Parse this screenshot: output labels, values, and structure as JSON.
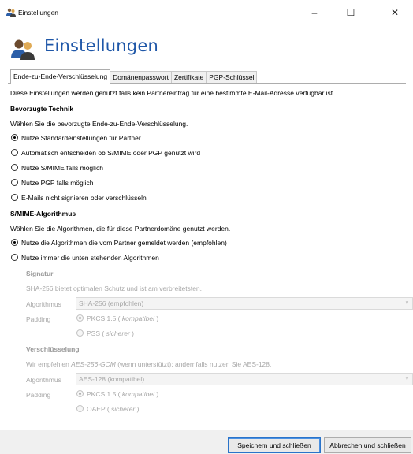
{
  "window": {
    "title": "Einstellungen",
    "minimize_glyph": "–",
    "maximize_glyph": "☐",
    "close_glyph": "✕"
  },
  "header": {
    "title": "Einstellungen"
  },
  "tabs": [
    {
      "label": "Ende-zu-Ende-Verschlüsselung",
      "active": true
    },
    {
      "label": "Domänenpasswort",
      "active": false
    },
    {
      "label": "Zertifikate",
      "active": false
    },
    {
      "label": "PGP-Schlüssel",
      "active": false
    }
  ],
  "intro": "Diese Einstellungen werden genutzt falls kein Partnereintrag für eine bestimmte E-Mail-Adresse verfügbar ist.",
  "technique": {
    "heading": "Bevorzugte Technik",
    "description": "Wählen Sie die bevorzugte Ende-zu-Ende-Verschlüsselung.",
    "options": [
      {
        "label": "Nutze Standardeinstellungen für Partner",
        "checked": true
      },
      {
        "label": "Automatisch entscheiden ob S/MIME oder PGP genutzt wird",
        "checked": false
      },
      {
        "label": "Nutze S/MIME falls möglich",
        "checked": false
      },
      {
        "label": "Nutze PGP falls möglich",
        "checked": false
      },
      {
        "label": "E-Mails nicht signieren oder verschlüsseln",
        "checked": false
      }
    ]
  },
  "smime": {
    "heading": "S/MIME-Algorithmus",
    "description": "Wählen Sie die Algorithmen, die für diese Partnerdomäne genutzt werden.",
    "options": [
      {
        "label": "Nutze die Algorithmen die vom Partner gemeldet werden (empfohlen)",
        "checked": true
      },
      {
        "label": "Nutze immer die unten stehenden Algorithmen",
        "checked": false
      }
    ]
  },
  "signature": {
    "heading": "Signatur",
    "description": "SHA-256 bietet optimalen Schutz und ist am verbreitetsten.",
    "algorithm_label": "Algorithmus",
    "algorithm_value": "SHA-256 (empfohlen)",
    "padding_label": "Padding",
    "padding_options": [
      {
        "prefix": "PKCS 1.5 ( ",
        "emphasis": "kompatibel",
        "suffix": " )",
        "checked": true
      },
      {
        "prefix": "PSS ( ",
        "emphasis": "sicherer",
        "suffix": " )",
        "checked": false
      }
    ]
  },
  "encryption": {
    "heading": "Verschlüsselung",
    "description_prefix": "Wir empfehlen ",
    "description_emphasis": "AES-256-GCM",
    "description_suffix": " (wenn unterstützt); andernfalls nutzen Sie AES-128.",
    "algorithm_label": "Algorithmus",
    "algorithm_value": "AES-128 (kompatibel)",
    "padding_label": "Padding",
    "padding_options": [
      {
        "prefix": "PKCS 1.5 ( ",
        "emphasis": "kompatibel",
        "suffix": " )",
        "checked": true
      },
      {
        "prefix": "OAEP ( ",
        "emphasis": "sicherer",
        "suffix": " )",
        "checked": false
      }
    ]
  },
  "footer": {
    "save_label": "Speichern und schließen",
    "cancel_label": "Abbrechen und schließen"
  },
  "colors": {
    "accent": "#1f57a8",
    "disabled_text": "#9a9a9a"
  },
  "icons": {
    "app": "users-settings-icon",
    "header": "users-settings-icon"
  }
}
